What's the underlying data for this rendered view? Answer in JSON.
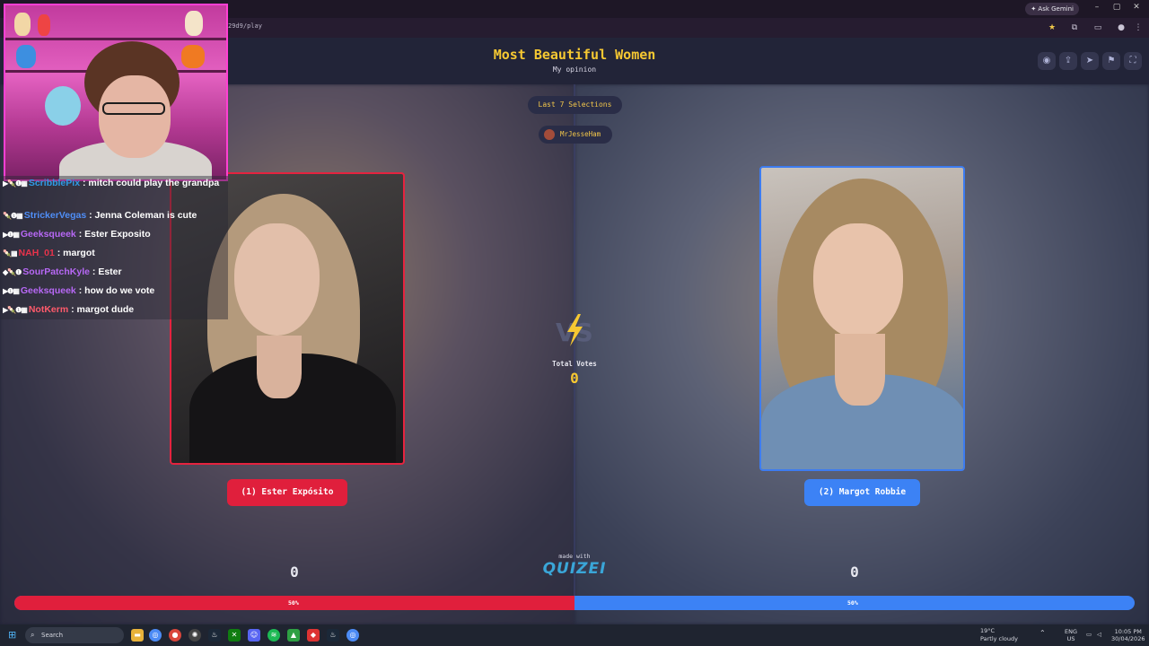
{
  "browser": {
    "url": "29d9/play",
    "ask_gemini": "Ask Gemini",
    "window_controls": [
      "–",
      "▢",
      "✕"
    ]
  },
  "header": {
    "title": "Most Beautiful Women",
    "subtitle": "My opinion"
  },
  "last_selections": "Last 7 Selections",
  "selector_user": "MrJesseHam",
  "contestants": [
    {
      "label": "(1) Ester Expósito",
      "score": "0",
      "percent": "50%",
      "share": 0.5,
      "color": "#e01f3c"
    },
    {
      "label": "(2) Margot Robbie",
      "score": "0",
      "percent": "50%",
      "share": 0.5,
      "color": "#3c82f5"
    }
  ],
  "total_votes": {
    "label": "Total Votes",
    "value": "0"
  },
  "made_with": "made with",
  "logo_text": "QUIZEI",
  "chat": [
    {
      "user": "ScribblePix",
      "user_color": "#2f9be6",
      "message": ": mitch could play the grandpa",
      "badges": "▶🍡❶▦"
    },
    {
      "user": "StrickerVegas",
      "user_color": "#4f8ef7",
      "message": ": Jenna Coleman is cute",
      "badges": "🍡❶▦"
    },
    {
      "user": "Geeksqueek",
      "user_color": "#b768f5",
      "message": ": Ester Exposito",
      "badges": "▶❶▦"
    },
    {
      "user": "NAH_01",
      "user_color": "#e8334b",
      "message": ": margot",
      "badges": "🍡▦"
    },
    {
      "user": "SourPatchKyle",
      "user_color": "#b768f5",
      "message": ": Ester",
      "badges": "◆🍡❶"
    },
    {
      "user": "Geeksqueek",
      "user_color": "#b768f5",
      "message": ": how do we vote",
      "badges": "▶❶▦"
    },
    {
      "user": "NotKerm",
      "user_color": "#ff5a6b",
      "message": ": margot dude",
      "badges": "▶🍡❶▦"
    }
  ],
  "taskbar": {
    "search": "Search",
    "weather_temp": "19°C",
    "weather_desc": "Partly cloudy",
    "lang": "ENG",
    "region": "US",
    "time": "10:05 PM",
    "date": "30/04/2026"
  },
  "colors": {
    "accent": "#f6c832",
    "left": "#e01f3c",
    "right": "#3c82f5"
  }
}
